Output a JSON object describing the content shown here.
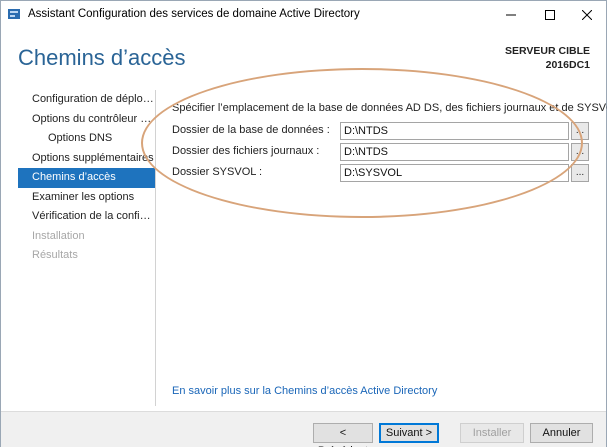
{
  "window": {
    "title": "Assistant Configuration des services de domaine Active Directory"
  },
  "header": {
    "title": "Chemins d’accès",
    "server_label_line1": "SERVEUR CIBLE",
    "server_label_line2": "2016DC1"
  },
  "nav": {
    "items": [
      {
        "label": "Configuration de déploie...",
        "state": "normal"
      },
      {
        "label": "Options du contrôleur de...",
        "state": "normal"
      },
      {
        "label": "Options DNS",
        "state": "sub"
      },
      {
        "label": "Options supplémentaires",
        "state": "normal"
      },
      {
        "label": "Chemins d’accès",
        "state": "active"
      },
      {
        "label": "Examiner les options",
        "state": "normal"
      },
      {
        "label": "Vérification de la configur...",
        "state": "normal"
      },
      {
        "label": "Installation",
        "state": "disabled"
      },
      {
        "label": "Résultats",
        "state": "disabled"
      }
    ]
  },
  "content": {
    "description": "Spécifier l’emplacement de la base de données AD DS, des fichiers journaux et de SYSVOL",
    "fields": [
      {
        "label": "Dossier de la base de données :",
        "value": "D:\\NTDS",
        "browse": "..."
      },
      {
        "label": "Dossier des fichiers journaux :",
        "value": "D:\\NTDS",
        "browse": "..."
      },
      {
        "label": "Dossier SYSVOL :",
        "value": "D:\\SYSVOL",
        "browse": "..."
      }
    ],
    "help_link": "En savoir plus sur la Chemins d’accès Active Directory"
  },
  "footer": {
    "prev_label": "< Précédent",
    "next_label": "Suivant >",
    "install_label": "Installer",
    "cancel_label": "Annuler"
  },
  "colors": {
    "accent": "#1e73be",
    "title_blue": "#2a6496",
    "link": "#1a66b8",
    "annotation": "#d8a47a"
  }
}
